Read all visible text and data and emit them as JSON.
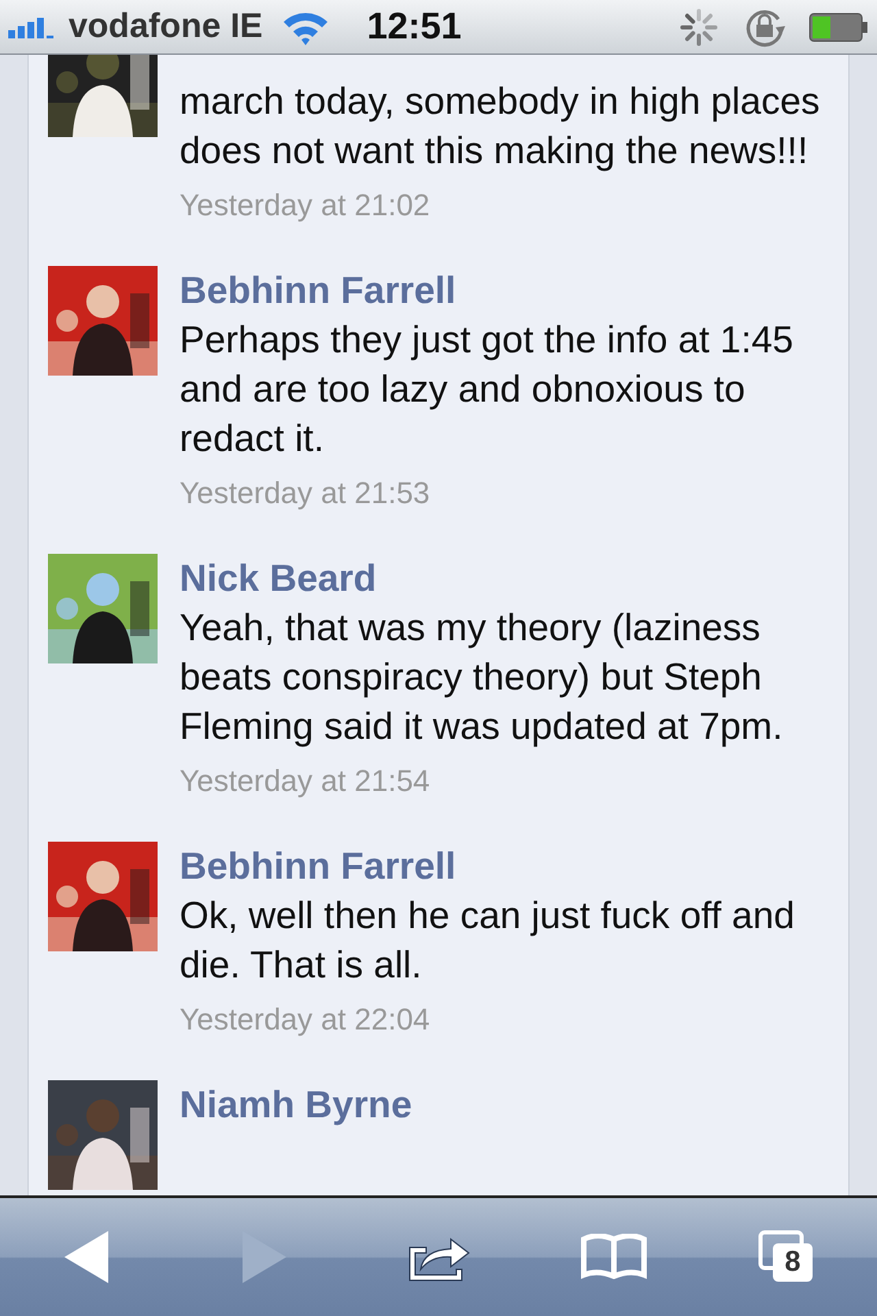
{
  "status_bar": {
    "carrier": "vodafone IE",
    "time": "12:51"
  },
  "comments": [
    {
      "body": "march today, somebody in high places does not want this making the news!!!",
      "time": "Yesterday at 21:02"
    },
    {
      "name": "Bebhinn Farrell",
      "body": "Perhaps they just got the info at 1:45 and are too lazy and obnoxious to redact it.",
      "time": "Yesterday at 21:53"
    },
    {
      "name": "Nick Beard",
      "body": "Yeah, that was my theory (laziness beats conspiracy theory) but Steph Fleming said it was updated at 7pm.",
      "time": "Yesterday at 21:54"
    },
    {
      "name": "Bebhinn Farrell",
      "body": "Ok, well then he can just fuck off and die. That is all.",
      "time": "Yesterday at 22:04"
    },
    {
      "name": "Niamh Byrne"
    }
  ],
  "toolbar": [
    {
      "kind": "back",
      "disabled": false
    },
    {
      "kind": "forward",
      "disabled": true
    },
    {
      "kind": "share",
      "disabled": false
    },
    {
      "kind": "bookmarks",
      "disabled": false
    },
    {
      "kind": "tabs",
      "disabled": false,
      "count": "8"
    }
  ]
}
